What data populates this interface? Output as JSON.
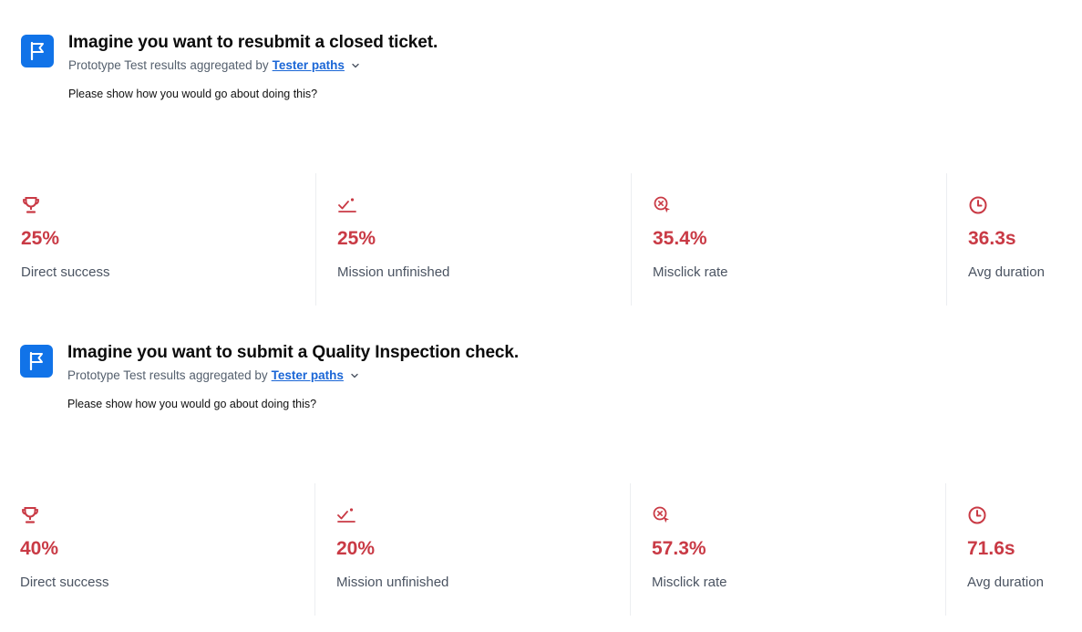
{
  "colors": {
    "accent": "#1173e8",
    "metric_value": "#c93a45",
    "link": "#1a66d6"
  },
  "tasks": [
    {
      "icon": "flag-icon",
      "title": "Imagine you want to resubmit a closed ticket.",
      "subtitle_prefix": "Prototype Test results aggregated by",
      "aggregation": "Tester paths",
      "prompt": "Please show how you would go about doing this?",
      "metrics": [
        {
          "icon": "trophy-icon",
          "value": "25%",
          "label": "Direct success"
        },
        {
          "icon": "mission-unfinished-icon",
          "value": "25%",
          "label": "Mission unfinished"
        },
        {
          "icon": "misclick-icon",
          "value": "35.4%",
          "label": "Misclick rate"
        },
        {
          "icon": "clock-icon",
          "value": "36.3s",
          "label": "Avg duration"
        }
      ]
    },
    {
      "icon": "flag-icon",
      "title": "Imagine you want to submit a Quality Inspection check.",
      "subtitle_prefix": "Prototype Test results aggregated by",
      "aggregation": "Tester paths",
      "prompt": "Please show how you would go about doing this?",
      "metrics": [
        {
          "icon": "trophy-icon",
          "value": "40%",
          "label": "Direct success"
        },
        {
          "icon": "mission-unfinished-icon",
          "value": "20%",
          "label": "Mission unfinished"
        },
        {
          "icon": "misclick-icon",
          "value": "57.3%",
          "label": "Misclick rate"
        },
        {
          "icon": "clock-icon",
          "value": "71.6s",
          "label": "Avg duration"
        }
      ]
    }
  ]
}
